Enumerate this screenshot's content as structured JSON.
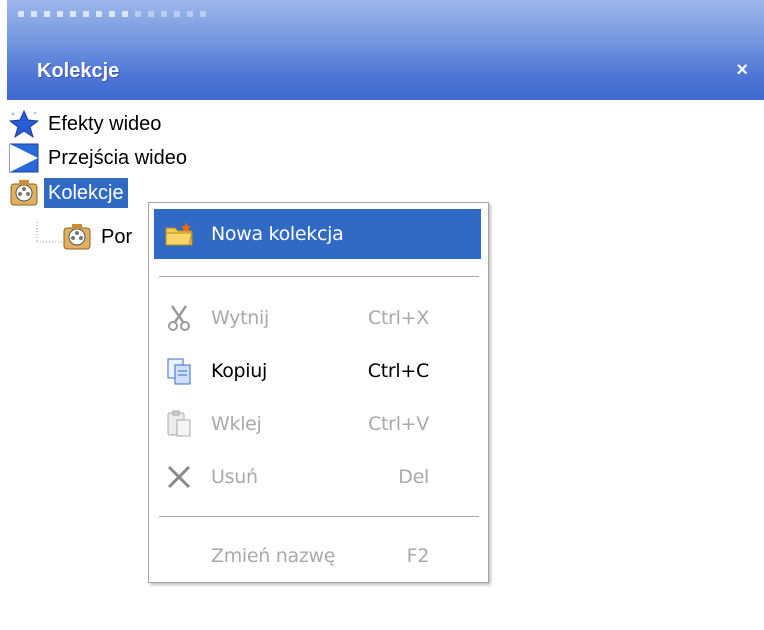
{
  "panel": {
    "title": "Kolekcje",
    "close_label": "×"
  },
  "tree": {
    "items": [
      {
        "label": "Efekty wideo",
        "icon": "star-icon"
      },
      {
        "label": "Przejścia wideo",
        "icon": "transition-icon"
      },
      {
        "label": "Kolekcje",
        "icon": "film-collection-icon",
        "selected": true
      },
      {
        "label": "Por",
        "icon": "film-collection-icon"
      }
    ]
  },
  "context_menu": {
    "items": [
      {
        "label": "Nowa kolekcja",
        "shortcut": "",
        "state": "highlighted",
        "icon": "new-folder-icon"
      },
      {
        "label": "Wytnij",
        "shortcut": "Ctrl+X",
        "state": "disabled",
        "icon": "scissors-icon"
      },
      {
        "label": "Kopiuj",
        "shortcut": "Ctrl+C",
        "state": "enabled",
        "icon": "copy-icon"
      },
      {
        "label": "Wklej",
        "shortcut": "Ctrl+V",
        "state": "disabled",
        "icon": "paste-icon"
      },
      {
        "label": "Usuń",
        "shortcut": "Del",
        "state": "disabled",
        "icon": "delete-x-icon"
      },
      {
        "label": "Zmień nazwę",
        "shortcut": "F2",
        "state": "disabled",
        "icon": ""
      }
    ]
  },
  "colors": {
    "highlight": "#316ac5",
    "header_top": "#9fb8ea",
    "header_bottom": "#3f69d2",
    "disabled_text": "#a9a9a9"
  }
}
